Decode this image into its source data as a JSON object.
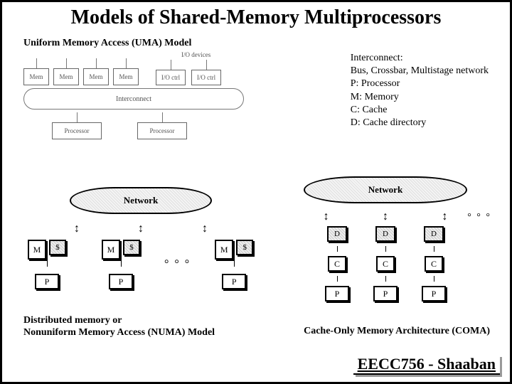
{
  "title": "Models of Shared-Memory Multiprocessors",
  "uma_subtitle": "Uniform Memory Access (UMA) Model",
  "legend": {
    "l1": "Interconnect:",
    "l2": "Bus, Crossbar, Multistage network",
    "l3": "P:  Processor",
    "l4": "M: Memory",
    "l5": "C: Cache",
    "l6": "D: Cache directory"
  },
  "uma": {
    "mem": "Mem",
    "io_devices": "I/O devices",
    "ioctrl": "I/O ctrl",
    "interconnect": "Interconnect",
    "processor": "Processor"
  },
  "network_label": "Network",
  "box": {
    "M": "M",
    "D": "$",
    "P": "P",
    "C": "C",
    "Dcap": "D"
  },
  "dots": "° ° °",
  "numa_label_1": "Distributed memory or",
  "numa_label_2": "Nonuniform Memory Access (NUMA) Model",
  "coma_label": "Cache-Only Memory Architecture (COMA)",
  "footer": "EECC756 - Shaaban"
}
